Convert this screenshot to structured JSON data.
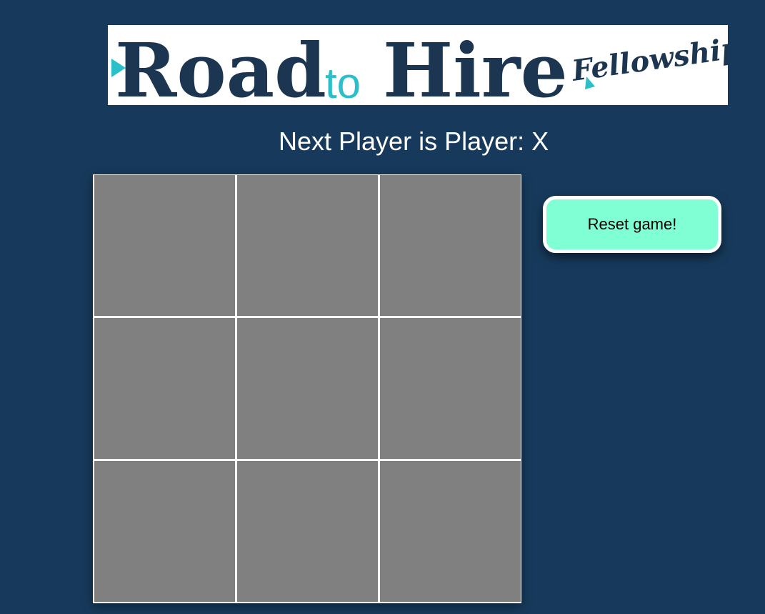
{
  "logo": {
    "word_road": "Road",
    "word_to": "to",
    "word_hire": "Hire",
    "word_fellowships": "Fellowships",
    "color_navy": "#1c3550",
    "color_teal": "#2bbfc9"
  },
  "status": {
    "text": "Next Player is Player: X"
  },
  "board": {
    "cells": [
      "",
      "",
      "",
      "",
      "",
      "",
      "",
      "",
      ""
    ],
    "cell_color": "#808080",
    "line_color": "#ffffff"
  },
  "reset_button": {
    "label": "Reset game!",
    "color": "#80ffd4"
  },
  "background_color": "#173a5c"
}
